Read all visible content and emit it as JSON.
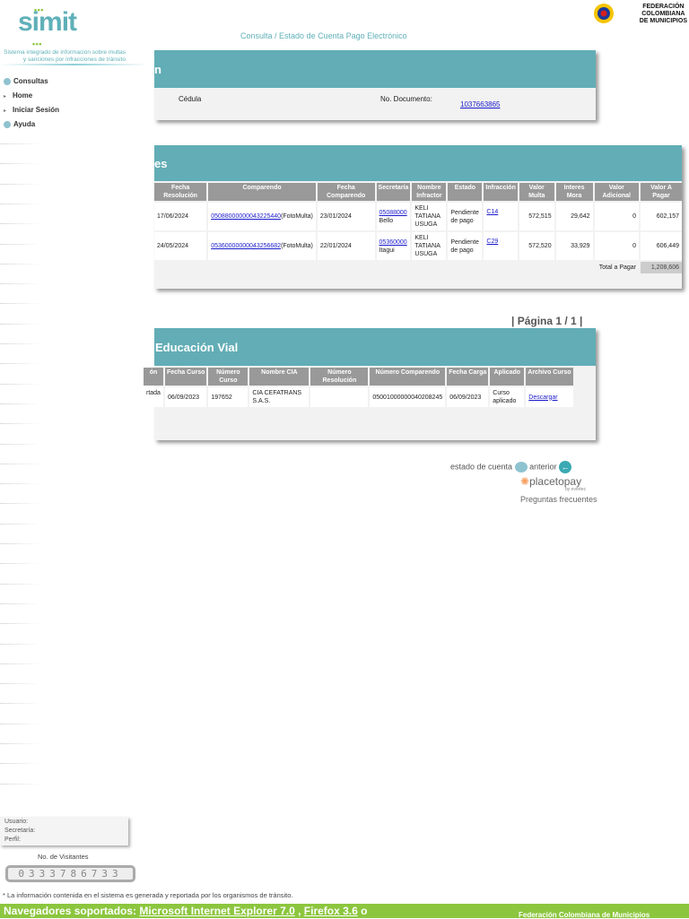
{
  "header": {
    "logo": "simit",
    "tagline": "Sistema integrado de información sobre multas y sanciones por infracciones de tránsito",
    "breadcrumb_prefix": "Consulta /",
    "breadcrumb_title": "Estado de Cuenta Pago Electrónico",
    "federation_logo": "FEDERACIÓN COLOMBIANA DE MUNICIPIOS"
  },
  "sidebar": {
    "items": [
      {
        "label": "Consultas",
        "icon": "bullet-icon"
      },
      {
        "label": "Home",
        "icon": "arrow-icon"
      },
      {
        "label": "Iniciar Sesión",
        "icon": "arrow-icon"
      },
      {
        "label": "Ayuda",
        "icon": "bullet-icon"
      }
    ],
    "user_box": {
      "usuario": "Usuario:",
      "secretaria": "Secretaría:",
      "perfil": "Perfil:"
    },
    "visitors_label": "No. de Visitantes",
    "visitors_count": "0333786733"
  },
  "person": {
    "title_fragment": "n",
    "doc_type": "Cédula",
    "doc_label": "No. Documento:",
    "doc_number": "1037663865"
  },
  "fines": {
    "title_fragment": "es",
    "columns": [
      "Fecha Resolución",
      "Comparendo",
      "Fecha Comparendo",
      "Secretaría",
      "Nombre Infractor",
      "Estado",
      "Infracción",
      "Valor Multa",
      "Interes Mora",
      "Valor Adicional",
      "Valor A Pagar"
    ],
    "rows": [
      {
        "fecha_res": "17/06/2024",
        "comparendo": "05088000000043225440",
        "tipo": "(FotoMulta)",
        "fecha_comp": "23/01/2024",
        "sec_code": "05088000",
        "sec_name": "Bello",
        "nombre": "KELI TATIANA USUGA",
        "estado": "Pendiente de pago",
        "infraccion": "C14",
        "multa": "572,515",
        "mora": "29,642",
        "adicional": "0",
        "pagar": "602,157"
      },
      {
        "fecha_res": "24/05/2024",
        "comparendo": "05360000000043256682",
        "tipo": "(FotoMulta)",
        "fecha_comp": "22/01/2024",
        "sec_code": "05360000",
        "sec_name": "Itagui",
        "nombre": "KELI TATIANA USUGA",
        "estado": "Pendiente de pago",
        "infraccion": "C29",
        "multa": "572,520",
        "mora": "33,929",
        "adicional": "0",
        "pagar": "606,449"
      }
    ],
    "total_label": "Total a Pagar",
    "total": "1,208,606"
  },
  "pagination": "| Página 1 / 1  |",
  "courses": {
    "title_fragment": "Educación Vial",
    "columns": [
      "ón",
      "Fecha Curso",
      "Número Curso",
      "Nombre CIA",
      "Número Resolución",
      "Número Comparendo",
      "Fecha Carga",
      "Aplicado",
      "Archivo Curso"
    ],
    "rows": [
      {
        "c0": "rtada",
        "fecha": "06/09/2023",
        "numero": "197652",
        "cia": "CIA CEFATRANS S.A.S.",
        "resolucion": "",
        "comparendo": "05001000000040208245",
        "carga": "06/09/2023",
        "aplicado": "Curso aplicado",
        "archivo": "Descargar"
      }
    ]
  },
  "links": {
    "estado": "estado de cuenta",
    "anterior": "anterior",
    "placetopay": "placetopay",
    "evertec": "by evertec",
    "faq": "Preguntas frecuentes"
  },
  "footer": {
    "note": "* La información contenida en el sistema es generada y reportada por los organismos de tránsito.",
    "browsers_label": "Navegadores soportados:",
    "ie": "Microsoft Internet Explorer 7.0",
    "firefox": "Firefox 3.6",
    "or": "o",
    "federation": "Federación Colombiana de Municipios"
  }
}
